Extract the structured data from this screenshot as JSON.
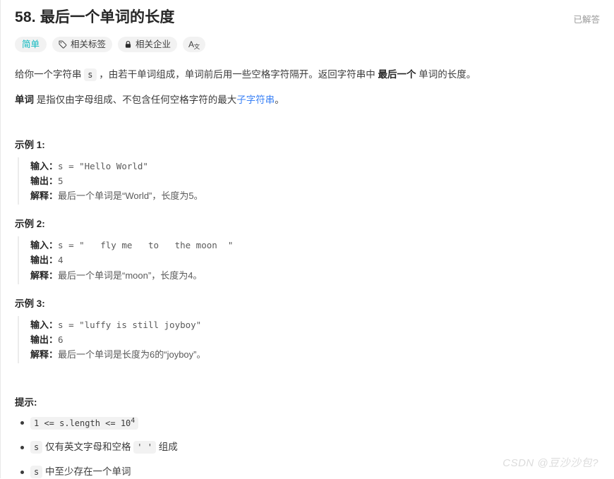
{
  "header": {
    "title": "58. 最后一个单词的长度",
    "status": "已解答"
  },
  "badges": {
    "difficulty": "简单",
    "topics": "相关标签",
    "companies": "相关企业",
    "translate_main": "A",
    "translate_sub": "文"
  },
  "description": {
    "p1_a": "给你一个字符串 ",
    "p1_code": "s",
    "p1_b": " ，由若干单词组成，单词前后用一些空格字符隔开。返回字符串中 ",
    "p1_bold": "最后一个",
    "p1_c": " 单词的长度。",
    "p2_bold": "单词",
    "p2_a": " 是指仅由字母组成、不包含任何空格字符的最大",
    "p2_link": "子字符串",
    "p2_b": "。"
  },
  "labels": {
    "input": "输入：",
    "output": "输出：",
    "explain": "解释："
  },
  "examples": [
    {
      "title": "示例 1:",
      "input": "s = \"Hello World\"",
      "output": "5",
      "explanation": "最后一个单词是“World”，长度为5。"
    },
    {
      "title": "示例 2:",
      "input": "s = \"   fly me   to   the moon  \"",
      "output": "4",
      "explanation": "最后一个单词是“moon”，长度为4。"
    },
    {
      "title": "示例 3:",
      "input": "s = \"luffy is still joyboy\"",
      "output": "6",
      "explanation": "最后一个单词是长度为6的“joyboy”。"
    }
  ],
  "hints": {
    "title": "提示:",
    "items": [
      {
        "code_pre": "1 <= s.length <= 10",
        "code_sup": "4",
        "text_after": ""
      },
      {
        "code_pre": "s",
        "text_mid": " 仅有英文字母和空格 ",
        "code_post": "' '",
        "text_after": " 组成"
      },
      {
        "code_pre": "s",
        "text_mid": " 中至少存在一个单词",
        "text_after": ""
      }
    ]
  },
  "watermark": "CSDN @豆沙沙包?"
}
